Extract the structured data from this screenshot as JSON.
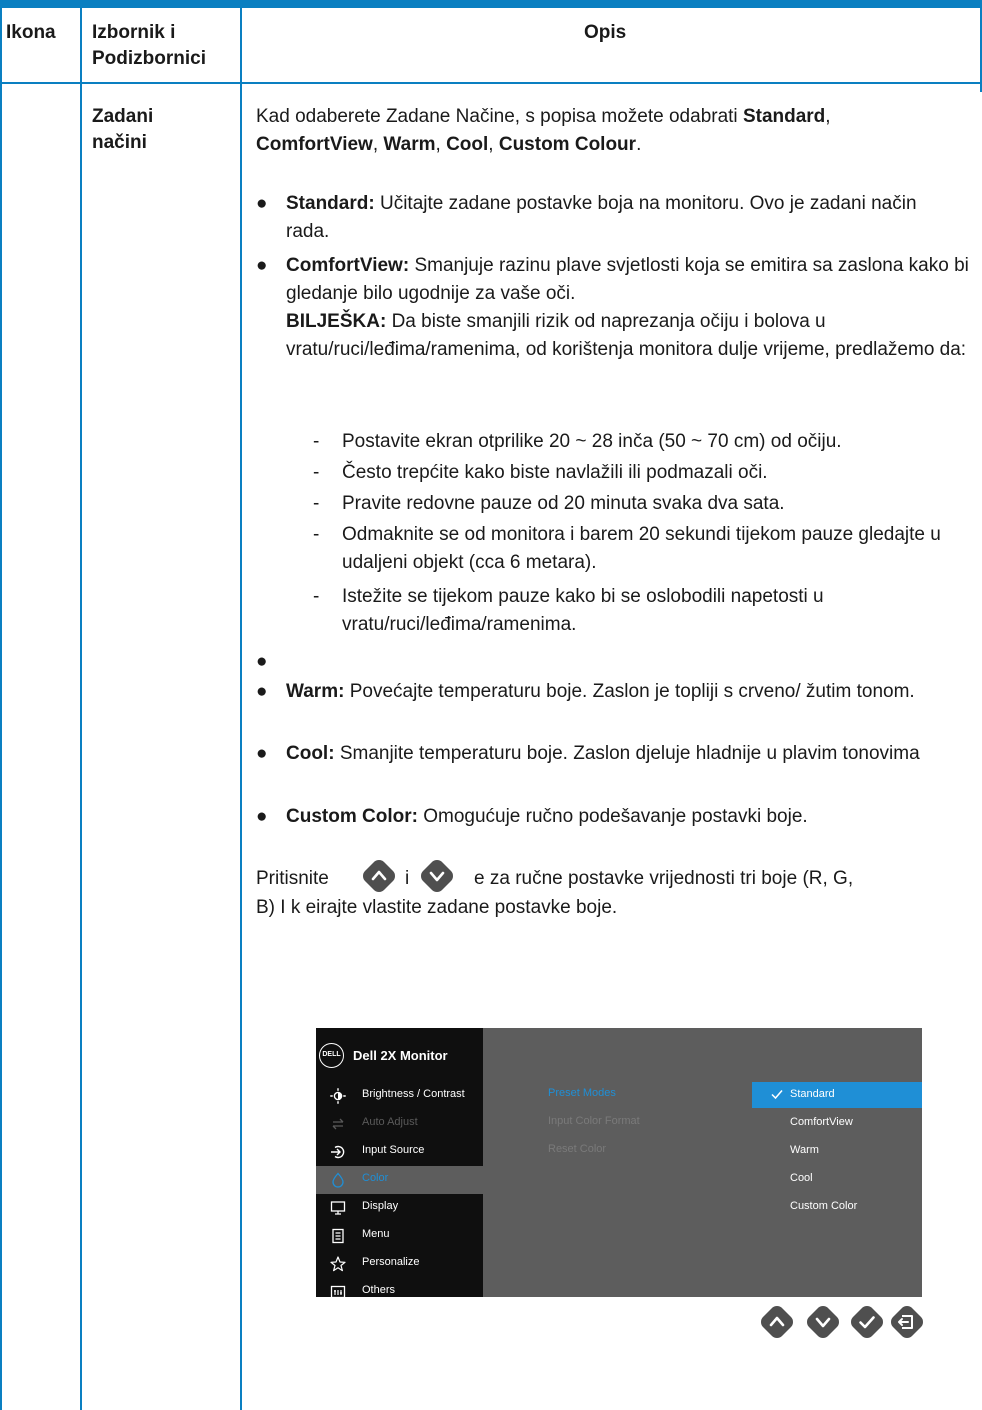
{
  "table": {
    "headers": {
      "icon": "Ikona",
      "menu_line1": "Izbornik i",
      "menu_line2": "Podizbornici",
      "desc": "Opis"
    },
    "row_menu_line1": "Zadani",
    "row_menu_line2": "načini"
  },
  "intro": {
    "t1": "Kad odaberete Zadane Načine, s popisa možete odabrati ",
    "b1": "Standard",
    "t2": ",",
    "b2": "ComfortView",
    "t3": ", ",
    "b3": "Warm",
    "t4": ", ",
    "b4": "Cool",
    "t5": ", ",
    "b5": "Custom Colour",
    "t6": "."
  },
  "bullets": {
    "standard_label": "Standard:",
    "standard_text": " Učitajte zadane postavke boja na monitoru. Ovo je zadani način rada.",
    "comfort_label": "ComfortView:",
    "comfort_text": " Smanjuje razinu plave svjetlosti koja se emitira sa zaslona kako bi gledanje bilo ugodnije za vaše oči.",
    "note_label": "BILJEŠKA:",
    "note_text": " Da biste smanjili rizik od naprezanja očiju i bolova u vratu/ruci/leđima/ramenima, od korištenja monitora dulje vrijeme, predlažemo da:",
    "dashes": [
      "Postavite ekran otprilike 20 ~ 28 inča (50 ~ 70 cm) od očiju.",
      "Često trepćite kako biste navlažili ili podmazali oči.",
      "Pravite redovne pauze od 20 minuta svaka dva sata.",
      "Odmaknite se od monitora i barem 20 sekundi tijekom pauze gledajte u udaljeni objekt (cca 6 metara).",
      "Istežite se tijekom pauze kako bi se oslobodili napetosti u vratu/ruci/leđima/ramenima."
    ],
    "warm_label": "Warm:",
    "warm_text": " Povećajte temperaturu boje. Zaslon je topliji s crveno/ žutim tonom.",
    "cool_label": "Cool:",
    "cool_text": " Smanjite temperaturu boje. Zaslon djeluje hladnije u plavim tonovima",
    "custom_label": "Custom Color:",
    "custom_text": " Omogućuje ručno podešavanje postavki boje."
  },
  "press": {
    "w1": "Pritisnite",
    "w2": "i",
    "w3": "e za ručne postavke vrijednosti tri boje (R, G,",
    "line2": "B) I k eirajte vlastite zadane postavke boje."
  },
  "osd": {
    "logo": "DELL",
    "title": "Dell 2X Monitor",
    "menu": [
      {
        "label": "Brightness / Contrast",
        "icon": "brightness-icon"
      },
      {
        "label": "Auto Adjust",
        "icon": "auto-adjust-icon"
      },
      {
        "label": "Input Source",
        "icon": "input-source-icon"
      },
      {
        "label": "Color",
        "icon": "color-icon"
      },
      {
        "label": "Display",
        "icon": "display-icon"
      },
      {
        "label": "Menu",
        "icon": "menu-icon"
      },
      {
        "label": "Personalize",
        "icon": "star-icon"
      },
      {
        "label": "Others",
        "icon": "others-icon"
      }
    ],
    "sub": [
      "Preset Modes",
      "Input Color Format",
      "Reset Color"
    ],
    "options": [
      "Standard",
      "ComfortView",
      "Warm",
      "Cool",
      "Custom Color"
    ],
    "accent": "#1f8fd6"
  },
  "colors": {
    "rule": "#0a7fc1",
    "osd_bg": "#5d5d5d",
    "osd_menu_bg": "#0f0f0f",
    "nav_button": "#4f4f4f"
  }
}
